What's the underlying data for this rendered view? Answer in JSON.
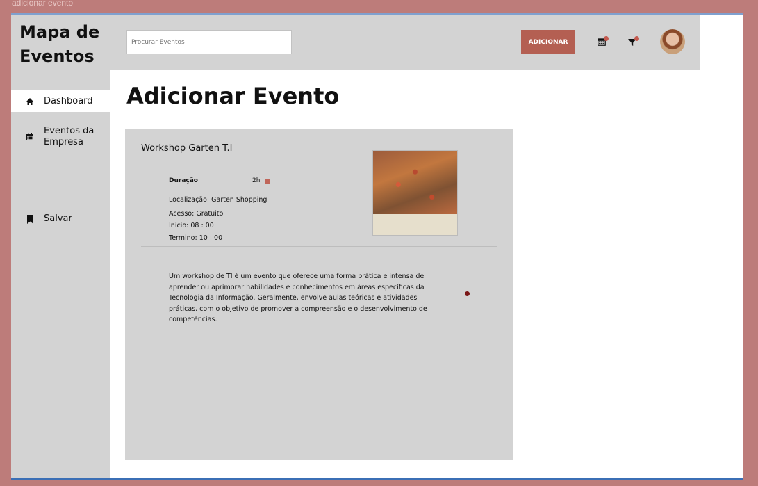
{
  "window": {
    "title": "adicionar evento"
  },
  "sidebar": {
    "brand": "Mapa de Eventos",
    "items": [
      {
        "label": "Dashboard",
        "icon": "home-icon"
      },
      {
        "label": "Eventos da Empresa",
        "icon": "calendar-icon"
      },
      {
        "label": "Salvar",
        "icon": "bookmark-icon"
      }
    ]
  },
  "header": {
    "search_placeholder": "Procurar Eventos",
    "add_button": "ADICIONAR",
    "icons": [
      "calendar-icon",
      "filter-icon",
      "avatar"
    ],
    "accent": "#b45f52"
  },
  "main": {
    "page_title": "Adicionar Evento",
    "event": {
      "name": "Workshop Garten T.I",
      "duration_label": "Duração",
      "duration_value": "2h",
      "location": "Localização: Garten Shopping",
      "access": "Acesso: Gratuito",
      "start": "Início: 08 : 00",
      "end": "Termino: 10 : 00",
      "description": "Um workshop de TI é um evento que oferece uma forma prática e intensa de aprender ou aprimorar habilidades e conhecimentos em áreas específicas da Tecnologia da Informação. Geralmente, envolve aulas teóricas e atividades práticas, com o objetivo de promover a compreensão e o desenvolvimento de competências."
    }
  }
}
